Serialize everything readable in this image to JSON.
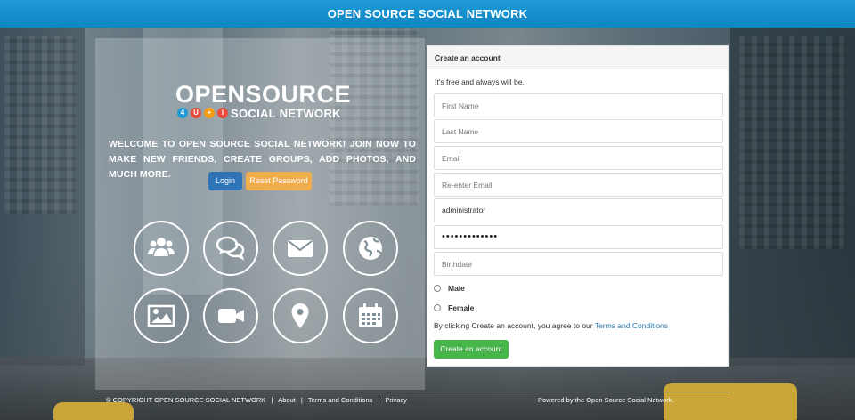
{
  "header": {
    "title": "OPEN SOURCE SOCIAL NETWORK"
  },
  "logo": {
    "main": "OPENSOURCE",
    "badges": [
      "4",
      "U",
      "+",
      "I"
    ],
    "sub": "SOCIAL NETWORK",
    "badge_colors": [
      "#1f9ad6",
      "#e74c3c",
      "#f39c12",
      "#e74c3c"
    ]
  },
  "welcome": "WELCOME TO OPEN SOURCE SOCIAL NETWORK! JOIN NOW TO MAKE NEW FRIENDS, CREATE GROUPS, ADD PHOTOS, AND MUCH MORE.",
  "buttons": {
    "login": "Login",
    "reset": "Reset Password"
  },
  "features": [
    {
      "icon": "users-icon"
    },
    {
      "icon": "chat-icon"
    },
    {
      "icon": "envelope-icon"
    },
    {
      "icon": "globe-icon"
    },
    {
      "icon": "image-icon"
    },
    {
      "icon": "video-camera-icon"
    },
    {
      "icon": "map-marker-icon"
    },
    {
      "icon": "calendar-icon"
    }
  ],
  "form": {
    "title": "Create an account",
    "tagline": "It's free and always will be.",
    "first_name_placeholder": "First Name",
    "last_name_placeholder": "Last Name",
    "email_placeholder": "Email",
    "reemail_placeholder": "Re-enter Email",
    "username_value": "administrator",
    "password_value": "•••••••••••••",
    "birthdate_placeholder": "Birthdate",
    "gender_male": "Male",
    "gender_female": "Female",
    "terms_prefix": "By clicking Create an account, you agree to our",
    "terms_link": "Terms and Conditions",
    "submit": "Create an account"
  },
  "footer": {
    "copyright": "© COPYRIGHT OPEN SOURCE SOCIAL NETWORK",
    "links": [
      "About",
      "Terms and Conditions",
      "Privacy"
    ],
    "powered": "Powered by the Open Source Social Network."
  },
  "colors": {
    "topbar": "#1286c4",
    "login_btn": "#2f74b7",
    "reset_btn": "#f0ad4e",
    "create_btn": "#46b54a",
    "link": "#2a7ab0"
  }
}
